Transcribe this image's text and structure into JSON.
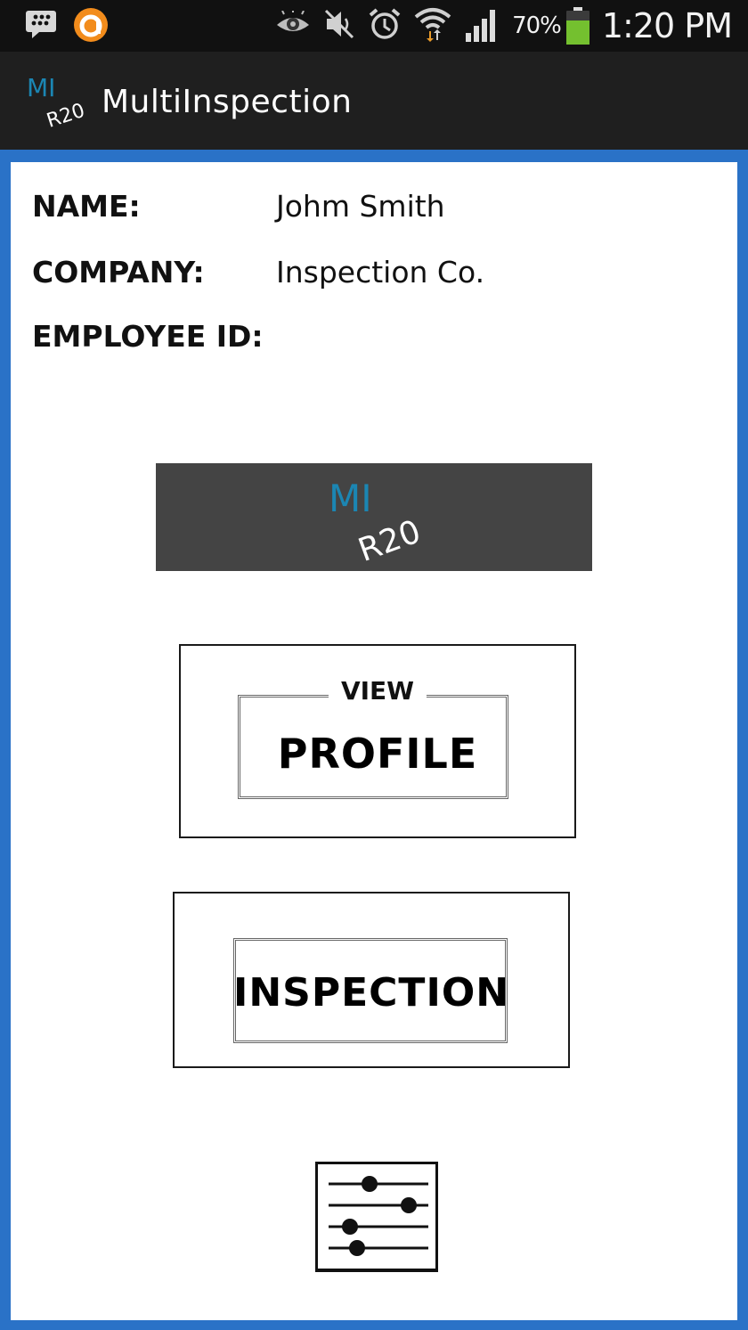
{
  "status_bar": {
    "icons": [
      "bbm-icon",
      "avast-icon",
      "eye-icon",
      "mute-icon",
      "alarm-icon",
      "wifi-icon",
      "signal-icon"
    ],
    "battery_percent": "70%",
    "battery_level": 0.7,
    "time": "1:20 PM",
    "colors": {
      "battery": "#74c02f",
      "avast": "#f28c1c"
    }
  },
  "action_bar": {
    "logo_text_top": "MI",
    "logo_text_bottom": "R20",
    "title": "MultiInspection"
  },
  "profile_info": {
    "name_label": "NAME:",
    "name_value": "Johm Smith",
    "company_label": "COMPANY:",
    "company_value": "Inspection Co.",
    "employee_id_label": "EMPLOYEE ID:",
    "employee_id_value": ""
  },
  "banner": {
    "logo_text_top": "MI",
    "logo_text_bottom": "R20",
    "colors": {
      "logo_top": "#1b86b3",
      "logo_bottom": "#ffffff",
      "background": "#444444"
    }
  },
  "buttons": {
    "view_profile": {
      "small": "VIEW",
      "big": "PROFILE"
    },
    "inspection": {
      "big": "INSPECTION"
    },
    "settings": {
      "icon": "sliders-icon"
    }
  },
  "colors": {
    "frame": "#2a72c7",
    "status_bar": "#111111",
    "action_bar": "#1f1f1f",
    "content": "#ffffff"
  }
}
